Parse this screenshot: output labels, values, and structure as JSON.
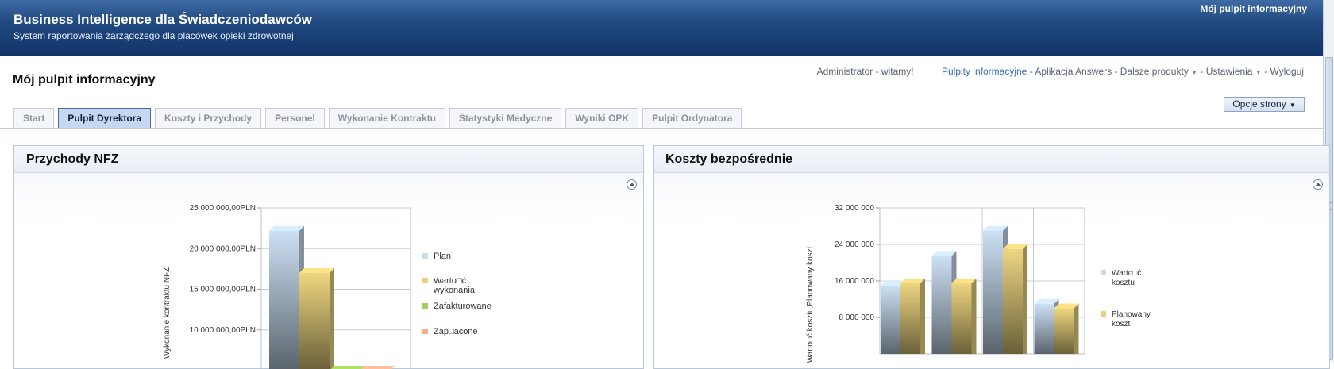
{
  "banner": {
    "title": "Business Intelligence dla Świadczeniodawców",
    "subtitle": "System raportowania zarządczego dla placówek opieki zdrowotnej",
    "dashboard_link": "Mój pulpit informacyjny"
  },
  "page": {
    "title": "Mój pulpit informacyjny"
  },
  "userbar": {
    "greeting": "Administrator - witamy!",
    "dashboards": "Pulpity informacyjne",
    "answers": "Aplikacja Answers",
    "more": "Dalsze produkty",
    "settings": "Ustawienia",
    "logout": "Wyloguj",
    "sep": "-"
  },
  "tabs": [
    {
      "label": "Start",
      "selected": false
    },
    {
      "label": "Pulpit Dyrektora",
      "selected": true
    },
    {
      "label": "Koszty i Przychody",
      "selected": false
    },
    {
      "label": "Personel",
      "selected": false
    },
    {
      "label": "Wykonanie Kontraktu",
      "selected": false
    },
    {
      "label": "Statystyki Medyczne",
      "selected": false
    },
    {
      "label": "Wyniki OPK",
      "selected": false
    },
    {
      "label": "Pulpit Ordynatora",
      "selected": false
    }
  ],
  "page_options": {
    "label": "Opcje strony"
  },
  "colors": {
    "banner": "#204a80",
    "tab_selected": "#c5d7f1",
    "link": "#3b6fb0"
  },
  "panels": {
    "left": {
      "title": "Przychody NFZ"
    },
    "right": {
      "title": "Koszty bezpośrednie"
    }
  },
  "chart_data": [
    {
      "type": "bar",
      "ylabel": "Wykonanie kontraktu NFZ",
      "yticks": [
        "25 000 000,00PLN",
        "20 000 000,00PLN",
        "15 000 000,00PLN",
        "10 000 000,00PLN"
      ],
      "ylim": [
        0,
        25000000
      ],
      "grid": true,
      "legend_position": "right",
      "categories": [
        ""
      ],
      "series": [
        {
          "name": "Plan",
          "values": [
            21500000
          ],
          "color": "#c9ddf0"
        },
        {
          "name": "Warto□ć wykonania",
          "values": [
            15000000
          ],
          "color": "#e9d27e"
        },
        {
          "name": "Zafakturowane",
          "values": [
            0
          ],
          "color": "#a3cf5c"
        },
        {
          "name": "Zap□acone",
          "values": [
            0
          ],
          "color": "#f3b190"
        }
      ]
    },
    {
      "type": "bar",
      "ylabel": "Warto□ć kosztu,Planowany koszt",
      "yticks": [
        "32 000 000",
        "24 000 000",
        "16 000 000",
        "8 000 000"
      ],
      "ylim": [
        0,
        32000000
      ],
      "grid": true,
      "legend_position": "right",
      "categories": [
        "",
        "",
        "",
        ""
      ],
      "series": [
        {
          "name": "Warto□ć kosztu",
          "values": [
            15000000,
            21500000,
            27000000,
            11000000
          ],
          "color": "#c9ddf0"
        },
        {
          "name": "Planowany koszt",
          "values": [
            15500000,
            15500000,
            23000000,
            10000000
          ],
          "color": "#e9d27e"
        }
      ]
    }
  ]
}
